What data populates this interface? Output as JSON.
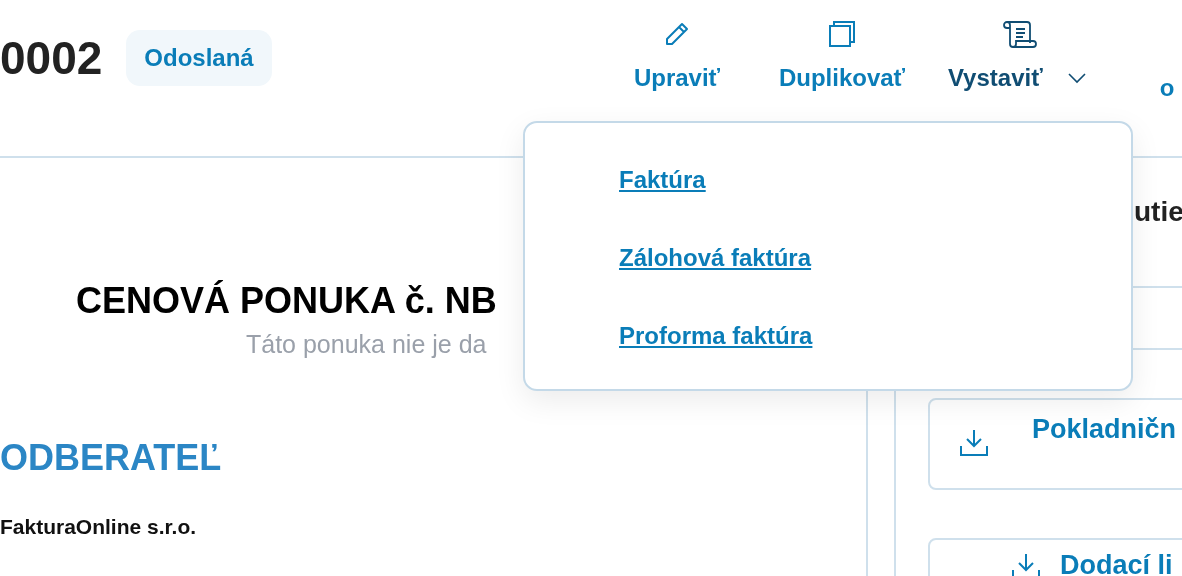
{
  "header": {
    "title": "0002",
    "status": "Odoslaná"
  },
  "actions": [
    {
      "kind": "edit",
      "label": "Upraviť",
      "dropdown": false
    },
    {
      "kind": "duplicate",
      "label": "Duplikovať",
      "dropdown": false
    },
    {
      "kind": "issue",
      "label": "Vystaviť",
      "dropdown": true
    },
    {
      "kind": "more",
      "label": "o",
      "dropdown": false
    }
  ],
  "issue_menu": {
    "items": [
      "Faktúra",
      "Zálohová faktúra",
      "Proforma faktúra"
    ]
  },
  "document": {
    "title": "CENOVÁ PONUKA č. NB",
    "subtitle": "Táto ponuka nie je da",
    "section": "ODBERATEĽ",
    "customer": "FakturaOnline s.r.o."
  },
  "side_panel": {
    "heading": "utie",
    "downloads": [
      "Pokladničn",
      "Dodací li"
    ]
  }
}
